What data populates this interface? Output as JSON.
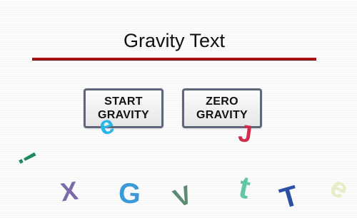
{
  "page": {
    "title": "Gravity Text"
  },
  "buttons": {
    "start": "START GRAVITY",
    "zero": "ZERO GRAVITY"
  },
  "letters": [
    {
      "char": "e",
      "color": "#29b6ea"
    },
    {
      "char": "J",
      "color": "#d12a4a"
    },
    {
      "char": "!",
      "color": "#1f8a5e"
    },
    {
      "char": "X",
      "color": "#7b6aa8"
    },
    {
      "char": "G",
      "color": "#3a9ad9"
    },
    {
      "char": "V",
      "color": "#5d8a72"
    },
    {
      "char": "t",
      "color": "#5fc6a6"
    },
    {
      "char": "T",
      "color": "#2a4fa3"
    },
    {
      "char": "e",
      "color": "#e7edc4"
    }
  ]
}
